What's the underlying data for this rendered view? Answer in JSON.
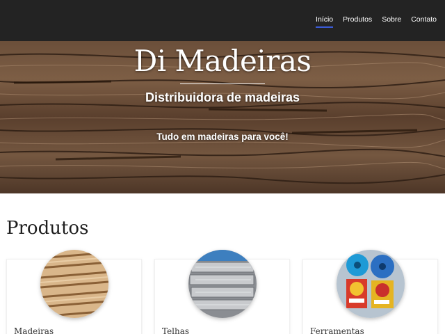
{
  "nav": {
    "items": [
      {
        "label": "Início",
        "active": true
      },
      {
        "label": "Produtos",
        "active": false
      },
      {
        "label": "Sobre",
        "active": false
      },
      {
        "label": "Contato",
        "active": false
      }
    ]
  },
  "hero": {
    "title": "Di Madeiras",
    "subtitle": "Distribuidora de madeiras",
    "tagline": "Tudo em madeiras para você!"
  },
  "products": {
    "section_title": "Produtos",
    "items": [
      {
        "label": "Madeiras",
        "icon": "lumber-stack-image"
      },
      {
        "label": "Telhas",
        "icon": "roof-tiles-image"
      },
      {
        "label": "Ferramentas",
        "icon": "saw-blades-image"
      }
    ]
  },
  "colors": {
    "navbar_bg": "#232323",
    "nav_active_underline": "#3b5bd9",
    "wood_dark": "#3f2a1c",
    "wood_light": "#8a6a4e"
  }
}
